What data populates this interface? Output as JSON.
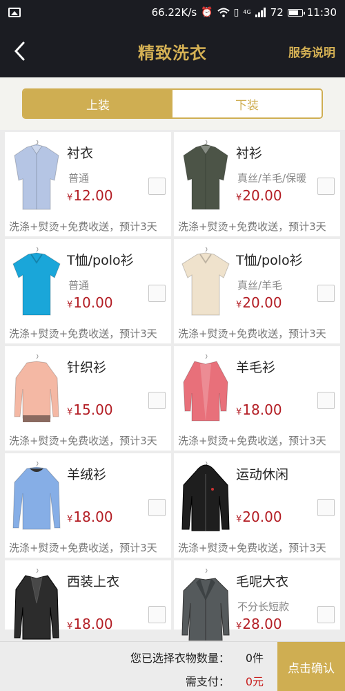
{
  "status_bar": {
    "speed": "66.22K/s",
    "network": "4G",
    "battery": "72",
    "battery_level": 0.72,
    "time": "11:30"
  },
  "header": {
    "title": "精致洗衣",
    "action": "服务说明"
  },
  "tabs": [
    {
      "label": "上装",
      "active": true
    },
    {
      "label": "下装",
      "active": false
    }
  ],
  "currency": "¥",
  "items": [
    {
      "name": "衬衣",
      "sub": "普通",
      "price": "12.00",
      "desc": "洗涤+熨烫+免费收送，预计3天",
      "icon": "dress-shirt-icon",
      "color": "#b5c5e4"
    },
    {
      "name": "衬衫",
      "sub": "真丝/羊毛/保暖",
      "price": "20.00",
      "desc": "洗涤+熨烫+免费收送，预计3天",
      "icon": "dark-shirt-icon",
      "color": "#4c5447"
    },
    {
      "name": "T恤/polo衫",
      "sub": "普通",
      "price": "10.00",
      "desc": "洗涤+熨烫+免费收送，预计3天",
      "icon": "polo-shirt-icon",
      "color": "#1aa6d9"
    },
    {
      "name": "T恤/polo衫",
      "sub": "真丝/羊毛",
      "price": "20.00",
      "desc": "洗涤+熨烫+免费收送，预计3天",
      "icon": "polo-shirt-icon",
      "color": "#efe2cc"
    },
    {
      "name": "针织衫",
      "sub": "",
      "price": "15.00",
      "desc": "洗涤+熨烫+免费收送，预计3天",
      "icon": "knit-sweater-icon",
      "color": "#f4b8a4"
    },
    {
      "name": "羊毛衫",
      "sub": "",
      "price": "18.00",
      "desc": "洗涤+熨烫+免费收送，预计3天",
      "icon": "cardigan-icon",
      "color": "#e8707a"
    },
    {
      "name": "羊绒衫",
      "sub": "",
      "price": "18.00",
      "desc": "洗涤+熨烫+免费收送，预计3天",
      "icon": "cashmere-sweater-icon",
      "color": "#86aee6"
    },
    {
      "name": "运动休闲",
      "sub": "",
      "price": "20.00",
      "desc": "洗涤+熨烫+免费收送，预计3天",
      "icon": "hoodie-icon",
      "color": "#1e1e1e"
    },
    {
      "name": "西装上衣",
      "sub": "",
      "price": "18.00",
      "desc": "",
      "icon": "blazer-icon",
      "color": "#2c2c2c"
    },
    {
      "name": "毛呢大衣",
      "sub": "不分长短款",
      "price": "28.00",
      "desc": "",
      "icon": "wool-coat-icon",
      "color": "#555a5c"
    }
  ],
  "footer": {
    "count_label": "您已选择衣物数量：",
    "count_value": "0件",
    "pay_label": "需支付：",
    "pay_value": "0元",
    "confirm_label": "点击确认"
  }
}
